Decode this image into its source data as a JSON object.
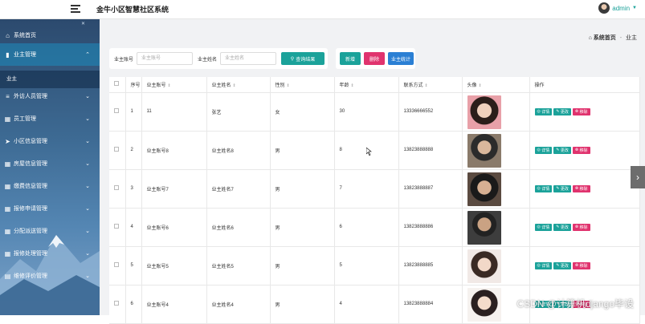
{
  "header": {
    "title": "金牛小区智慧社区系统",
    "user": "admin"
  },
  "sidebar": {
    "items": [
      {
        "label": "系统首页",
        "icon": "home-icon"
      },
      {
        "label": "业主管理",
        "icon": "bar-chart-icon"
      },
      {
        "label": "外访人员管理",
        "icon": "list-icon"
      },
      {
        "label": "员工管理",
        "icon": "grid-icon"
      },
      {
        "label": "小区信息管理",
        "icon": "send-icon"
      },
      {
        "label": "房屋信息管理",
        "icon": "grid-icon"
      },
      {
        "label": "缴费信息管理",
        "icon": "grid-icon"
      },
      {
        "label": "报修申请管理",
        "icon": "grid-icon"
      },
      {
        "label": "分配派送管理",
        "icon": "grid-icon"
      },
      {
        "label": "报修处理管理",
        "icon": "grid-icon"
      },
      {
        "label": "维修评价管理",
        "icon": "clipboard-icon"
      }
    ],
    "sub_item": "业主"
  },
  "breadcrumb": {
    "home": "系统首页",
    "current": "业主"
  },
  "search": {
    "label_account": "业主账号",
    "placeholder_account": "业主账号",
    "label_name": "业主姓名",
    "placeholder_name": "业主姓名",
    "query_button": "查询结果"
  },
  "actions": {
    "add": "新增",
    "delete": "删除",
    "stats": "业主统计"
  },
  "table": {
    "headers": [
      "序号",
      "业主账号",
      "业主姓名",
      "性别",
      "年龄",
      "联系方式",
      "头像",
      "操作"
    ],
    "rows": [
      {
        "idx": "1",
        "account": "11",
        "name": "张艺",
        "gender": "女",
        "age": "30",
        "phone": "13336666552"
      },
      {
        "idx": "2",
        "account": "业主账号8",
        "name": "业主姓名8",
        "gender": "男",
        "age": "8",
        "phone": "13823888888"
      },
      {
        "idx": "3",
        "account": "业主账号7",
        "name": "业主姓名7",
        "gender": "男",
        "age": "7",
        "phone": "13823888887"
      },
      {
        "idx": "4",
        "account": "业主账号6",
        "name": "业主姓名6",
        "gender": "男",
        "age": "6",
        "phone": "13823888886"
      },
      {
        "idx": "5",
        "account": "业主账号5",
        "name": "业主姓名5",
        "gender": "男",
        "age": "5",
        "phone": "13823888885"
      },
      {
        "idx": "6",
        "account": "业主账号4",
        "name": "业主姓名4",
        "gender": "男",
        "age": "4",
        "phone": "13823888884"
      }
    ],
    "ops": {
      "detail": "详情",
      "edit": "更改",
      "delete": "移除"
    }
  },
  "watermark": "CSDN @计算机django毕设",
  "colors": {
    "accent": "#1ba29a",
    "danger": "#e0336e",
    "info": "#2a7fd4"
  }
}
